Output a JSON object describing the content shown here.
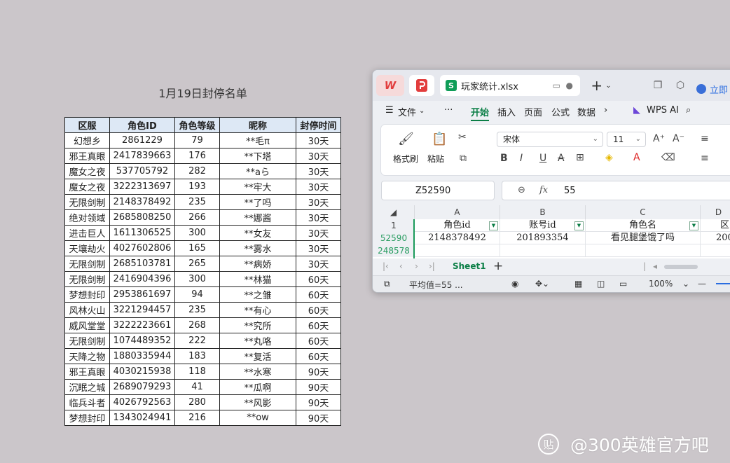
{
  "ban_list": {
    "title": "1月19日封停名单",
    "headers": [
      "区服",
      "角色ID",
      "角色等级",
      "昵称",
      "封停时间"
    ],
    "rows": [
      [
        "幻想乡",
        "2861229",
        "79",
        "**毛π",
        "30天"
      ],
      [
        "邪王真眼",
        "2417839663",
        "176",
        "**下塔",
        "30天"
      ],
      [
        "魔女之夜",
        "537705792",
        "282",
        "**aら",
        "30天"
      ],
      [
        "魔女之夜",
        "3222313697",
        "193",
        "**牢大",
        "30天"
      ],
      [
        "无限剑制",
        "2148378492",
        "235",
        "**了吗",
        "30天"
      ],
      [
        "绝对领域",
        "2685808250",
        "266",
        "**娜酱",
        "30天"
      ],
      [
        "进击巨人",
        "1611306525",
        "300",
        "**女友",
        "30天"
      ],
      [
        "天壤劫火",
        "4027602806",
        "165",
        "**雾水",
        "30天"
      ],
      [
        "无限剑制",
        "2685103781",
        "265",
        "**病娇",
        "30天"
      ],
      [
        "无限剑制",
        "2416904396",
        "300",
        "**林猫",
        "60天"
      ],
      [
        "梦想封印",
        "2953861697",
        "94",
        "**之雏",
        "60天"
      ],
      [
        "风林火山",
        "3221294457",
        "235",
        "**有心",
        "60天"
      ],
      [
        "威风堂堂",
        "3222223661",
        "268",
        "**究所",
        "60天"
      ],
      [
        "无限剑制",
        "1074489352",
        "222",
        "**丸咯",
        "60天"
      ],
      [
        "天降之物",
        "1880335944",
        "183",
        "**复活",
        "60天"
      ],
      [
        "邪王真眼",
        "4030215938",
        "118",
        "**水寒",
        "90天"
      ],
      [
        "沉眠之城",
        "2689079293",
        "41",
        "**瓜啊",
        "90天"
      ],
      [
        "临兵斗者",
        "4026792563",
        "280",
        "**风影",
        "90天"
      ],
      [
        "梦想封印",
        "1343024941",
        "216",
        "**ow",
        "90天"
      ]
    ]
  },
  "wps": {
    "tab_title": "玩家统计.xlsx",
    "login": "立即",
    "menu": [
      "文件",
      "开始",
      "插入",
      "页面",
      "公式",
      "数据",
      "WPS AI"
    ],
    "ribbon": {
      "format_painter": "格式刷",
      "paste": "粘贴",
      "font": "宋体",
      "size": "11"
    },
    "name_box": "Z52590",
    "formula_value": "55",
    "columns": [
      "A",
      "B",
      "C",
      "D"
    ],
    "row_numbers": [
      "1",
      "52590",
      "248578"
    ],
    "header_cells": [
      "角色id",
      "账号id",
      "角色名",
      "区"
    ],
    "data_cells": [
      "2148378492",
      "201893354",
      "看见腿堡饿了吗",
      "200"
    ],
    "sheet_name": "Sheet1",
    "status_avg": "平均值=55 ...",
    "zoom": "100%",
    "accent_color": "#0a7e45"
  },
  "watermark": {
    "text": "@300英雄官方吧",
    "badge": "贴"
  }
}
